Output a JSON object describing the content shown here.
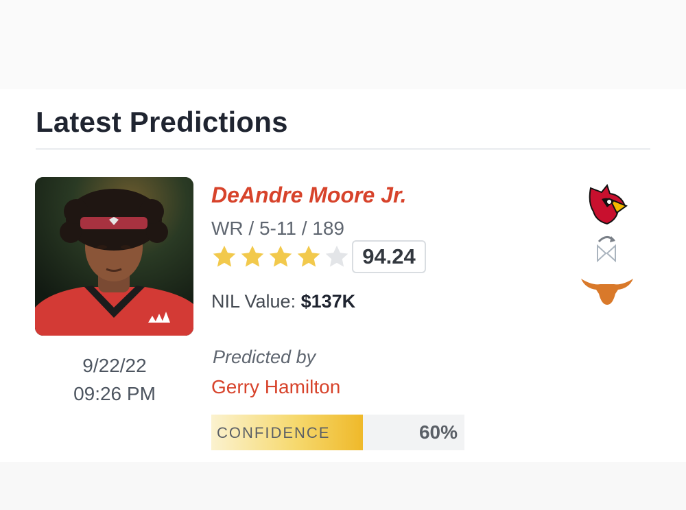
{
  "section": {
    "title": "Latest Predictions"
  },
  "prediction": {
    "player": {
      "name": "DeAndre Moore Jr.",
      "meta": "WR / 5-11 / 189",
      "stars_filled": 4,
      "stars_total": 5,
      "rating": "94.24",
      "nil_label": "NIL Value:",
      "nil_value": "$137K"
    },
    "date": "9/22/22",
    "time": "09:26 PM",
    "predicted_by_label": "Predicted by",
    "predictor": "Gerry Hamilton",
    "confidence": {
      "label": "CONFIDENCE",
      "percent_text": "60%",
      "value": 0.6
    },
    "teams": {
      "from_icon": "louisville-cardinal-logo",
      "switch_icon": "commit-switch-icon",
      "to_icon": "texas-longhorn-logo"
    }
  },
  "colors": {
    "accent_red": "#d7432b",
    "star_gold": "#f2c94c",
    "star_empty": "#e3e5e8",
    "texas_orange": "#d9792a"
  }
}
